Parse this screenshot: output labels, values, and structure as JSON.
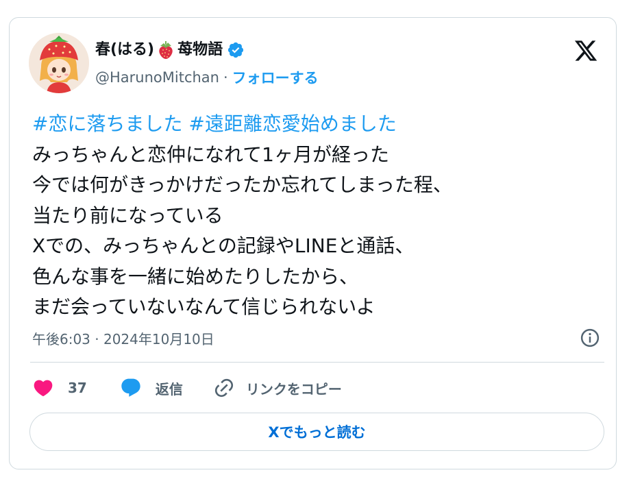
{
  "author": {
    "display_name_prefix": "春(はる)",
    "display_name_suffix": "苺物語",
    "handle": "@HarunoMitchan",
    "separator": "·",
    "follow_label": "フォローする"
  },
  "tweet": {
    "lines": [
      {
        "hashtags": [
          "#恋に落ちました",
          "#遠距離恋愛始めました"
        ]
      },
      {
        "text": "みっちゃんと恋仲になれて1ヶ月が経った"
      },
      {
        "text": "今では何がきっかけだったか忘れてしまった程、"
      },
      {
        "text": "当たり前になっている"
      },
      {
        "text": "Xでの、みっちゃんとの記録やLINEと通話、"
      },
      {
        "text": "色んな事を一緒に始めたりしたから、"
      },
      {
        "text": "まだ会っていないなんて信じられないよ"
      }
    ],
    "timestamp": "午後6:03 · 2024年10月10日"
  },
  "actions": {
    "like_count": "37",
    "reply_label": "返信",
    "copy_link_label": "リンクをコピー"
  },
  "read_more_label": "Xでもっと読む",
  "colors": {
    "accent": "#1d9bf0",
    "like": "#f91880",
    "text": "#0f1419",
    "secondary": "#536471",
    "border": "#cfd9de"
  }
}
